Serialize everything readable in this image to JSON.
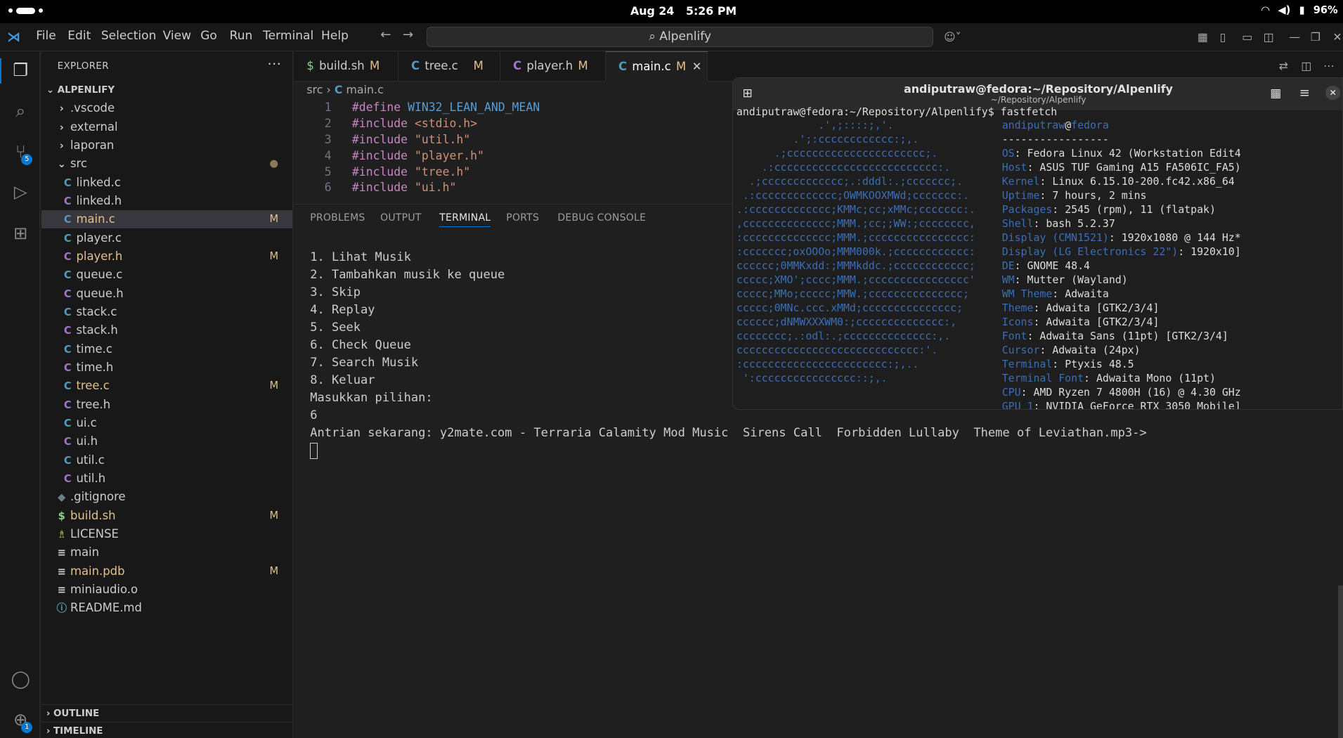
{
  "system": {
    "date": "Aug 24",
    "time": "5:26 PM",
    "battery": "96%"
  },
  "menubar": {
    "items": [
      "File",
      "Edit",
      "Selection",
      "View",
      "Go",
      "Run",
      "Terminal",
      "Help"
    ],
    "search": "Alpenlify"
  },
  "activity": {
    "scm_badge": "5",
    "account_badge": "1"
  },
  "sidebar": {
    "title": "EXPLORER",
    "root": "ALPENLIFY",
    "items": [
      {
        "name": ".vscode",
        "icon": "folder-closed-icon",
        "indent": 1
      },
      {
        "name": "external",
        "icon": "folder-closed-icon",
        "indent": 1
      },
      {
        "name": "laporan",
        "icon": "folder-closed-icon",
        "indent": 1
      },
      {
        "name": "src",
        "icon": "folder-open-icon",
        "indent": 1,
        "status": "●"
      },
      {
        "name": "linked.c",
        "icon": "c-file-icon",
        "indent": 2
      },
      {
        "name": "linked.h",
        "icon": "h-file-icon",
        "indent": 2
      },
      {
        "name": "main.c",
        "icon": "c-file-icon",
        "indent": 2,
        "status": "M",
        "selected": true
      },
      {
        "name": "player.c",
        "icon": "c-file-icon",
        "indent": 2
      },
      {
        "name": "player.h",
        "icon": "h-file-icon",
        "indent": 2,
        "status": "M"
      },
      {
        "name": "queue.c",
        "icon": "c-file-icon",
        "indent": 2
      },
      {
        "name": "queue.h",
        "icon": "h-file-icon",
        "indent": 2
      },
      {
        "name": "stack.c",
        "icon": "c-file-icon",
        "indent": 2
      },
      {
        "name": "stack.h",
        "icon": "h-file-icon",
        "indent": 2
      },
      {
        "name": "time.c",
        "icon": "c-file-icon",
        "indent": 2
      },
      {
        "name": "time.h",
        "icon": "h-file-icon",
        "indent": 2
      },
      {
        "name": "tree.c",
        "icon": "c-file-icon",
        "indent": 2,
        "status": "M"
      },
      {
        "name": "tree.h",
        "icon": "h-file-icon",
        "indent": 2
      },
      {
        "name": "ui.c",
        "icon": "c-file-icon",
        "indent": 2
      },
      {
        "name": "ui.h",
        "icon": "h-file-icon",
        "indent": 2
      },
      {
        "name": "util.c",
        "icon": "c-file-icon",
        "indent": 2
      },
      {
        "name": "util.h",
        "icon": "h-file-icon",
        "indent": 2
      },
      {
        "name": ".gitignore",
        "icon": "git-icon",
        "indent": 1
      },
      {
        "name": "build.sh",
        "icon": "shell-icon",
        "indent": 1,
        "status": "M"
      },
      {
        "name": "LICENSE",
        "icon": "license-icon",
        "indent": 1
      },
      {
        "name": "main",
        "icon": "file-icon",
        "indent": 1
      },
      {
        "name": "main.pdb",
        "icon": "file-icon",
        "indent": 1,
        "status": "M"
      },
      {
        "name": "miniaudio.o",
        "icon": "file-icon",
        "indent": 1
      },
      {
        "name": "README.md",
        "icon": "info-icon",
        "indent": 1
      }
    ],
    "outline": "OUTLINE",
    "timeline": "TIMELINE"
  },
  "tabs": [
    {
      "label": "build.sh",
      "icon": "$",
      "mod": "M"
    },
    {
      "label": "tree.c",
      "icon": "C",
      "mod": "M"
    },
    {
      "label": "player.h",
      "icon": "C",
      "mod": "M"
    },
    {
      "label": "main.c",
      "icon": "C",
      "mod": "M",
      "active": true
    }
  ],
  "breadcrumb": {
    "folder": "src",
    "file": "main.c"
  },
  "code": [
    {
      "n": "1",
      "dir": "#define",
      "arg": "WIN32_LEAN_AND_MEAN"
    },
    {
      "n": "2",
      "dir": "#include",
      "arg": "<stdio.h>"
    },
    {
      "n": "3",
      "dir": "#include",
      "arg": "\"util.h\""
    },
    {
      "n": "4",
      "dir": "#include",
      "arg": "\"player.h\""
    },
    {
      "n": "5",
      "dir": "#include",
      "arg": "\"tree.h\""
    },
    {
      "n": "6",
      "dir": "#include",
      "arg": "\"ui.h\""
    }
  ],
  "panel": {
    "tabs": [
      "PROBLEMS",
      "OUTPUT",
      "TERMINAL",
      "PORTS",
      "DEBUG CONSOLE"
    ],
    "terminal": [
      "1. Lihat Musik",
      "2. Tambahkan musik ke queue",
      "3. Skip",
      "4. Replay",
      "5. Seek",
      "6. Check Queue",
      "7. Search Musik",
      "8. Keluar",
      "Masukkan pilihan:",
      "6",
      "Antrian sekarang: y2mate.com - Terraria Calamity Mod Music  Sirens Call  Forbidden Lullaby  Theme of Leviathan.mp3->"
    ]
  },
  "ptyxis": {
    "title": "andiputraw@fedora:~/Repository/Alpenlify",
    "subtitle": "~/Repository/Alpenlify",
    "prompt": "andiputraw@fedora:~/Repository/Alpenlify$ fastfetch",
    "user": "andiputraw",
    "host": "fedora",
    "sep": "-----------------",
    "info": [
      {
        "k": "OS",
        "v": "Fedora Linux 42 (Workstation Edit4"
      },
      {
        "k": "Host",
        "v": "ASUS TUF Gaming A15 FA506IC_FA5)"
      },
      {
        "k": "Kernel",
        "v": "Linux 6.15.10-200.fc42.x86_64"
      },
      {
        "k": "Uptime",
        "v": "7 hours, 2 mins"
      },
      {
        "k": "Packages",
        "v": "2545 (rpm), 11 (flatpak)"
      },
      {
        "k": "Shell",
        "v": "bash 5.2.37"
      },
      {
        "k": "Display (CMN1521)",
        "v": "1920x1080 @ 144 Hz*"
      },
      {
        "k": "Display (LG Electronics 22\")",
        "v": "1920x10]"
      },
      {
        "k": "DE",
        "v": "GNOME 48.4"
      },
      {
        "k": "WM",
        "v": "Mutter (Wayland)"
      },
      {
        "k": "WM Theme",
        "v": "Adwaita"
      },
      {
        "k": "Theme",
        "v": "Adwaita [GTK2/3/4]"
      },
      {
        "k": "Icons",
        "v": "Adwaita [GTK2/3/4]"
      },
      {
        "k": "Font",
        "v": "Adwaita Sans (11pt) [GTK2/3/4]"
      },
      {
        "k": "Cursor",
        "v": "Adwaita (24px)"
      },
      {
        "k": "Terminal",
        "v": "Ptyxis 48.5"
      },
      {
        "k": "Terminal Font",
        "v": "Adwaita Mono (11pt)"
      },
      {
        "k": "CPU",
        "v": "AMD Ryzen 7 4800H (16) @ 4.30 GHz"
      },
      {
        "k": "GPU 1",
        "v": "NVIDIA GeForce RTX 3050 Mobile]"
      }
    ],
    "logo": [
      "             .',;::::;,'.",
      "         .';:cccccccccccc:;,.",
      "      .;cccccccccccccccccccccc;.",
      "    .:cccccccccccccccccccccccccc:.",
      "  .;ccccccccccccc;.:dddl:.;ccccccc;.",
      " .:ccccccccccccc;OWMKOOXMWd;ccccccc:.",
      ".:ccccccccccccc;KMMc;cc;xMMc;ccccccc:.",
      ",cccccccccccccc;MMM.;cc;;WW:;cccccccc,",
      ":cccccccccccccc;MMM.;cccccccccccccccc:",
      ":ccccccc;oxOOOo;MMM000k.;cccccccccccc:",
      "cccccc;0MMKxdd:;MMMkddc.;cccccccccccc;",
      "ccccc;XMO';cccc;MMM.;cccccccccccccccc'",
      "ccccc;MMo;ccccc;MMW.;ccccccccccccccc;",
      "ccccc;0MNc.ccc.xMMd;ccccccccccccccc;",
      "cccccc;dNMWXXXWM0:;cccccccccccccc:,",
      "cccccccc;.:odl:.;cccccccccccccc:,.",
      "ccccccccccccccccccccccccccccc:'.",
      ":ccccccccccccccccccccccc:;,..",
      " ':cccccccccccccccc::;,."
    ]
  }
}
